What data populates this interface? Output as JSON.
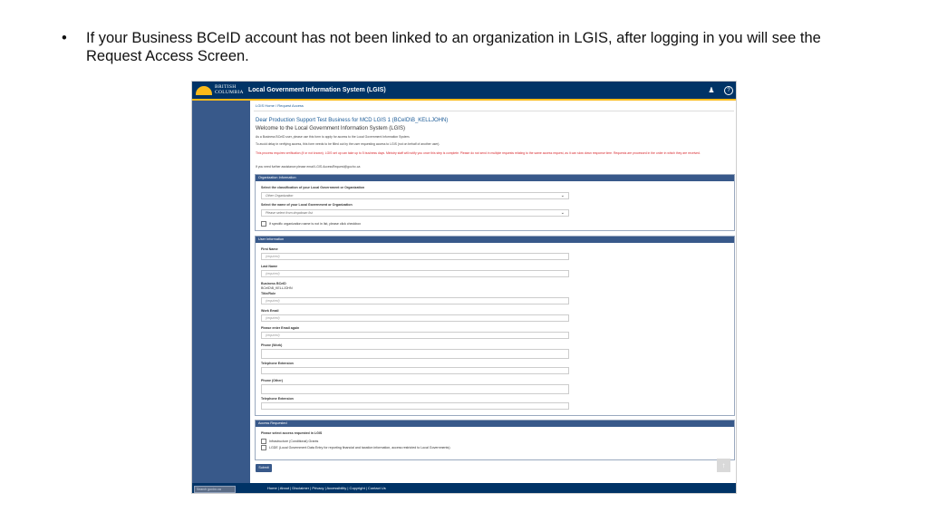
{
  "slide": {
    "bullet_glyph": "•",
    "bullet_text": "If your Business BCeID account has not been linked to an organization in LGIS, after logging in you will see the Request Access Screen."
  },
  "header": {
    "logo_line1": "BRITISH",
    "logo_line2": "COLUMBIA",
    "title": "Local Government Information System (LGIS)",
    "user_icon": "user-icon",
    "help_icon": "help-icon",
    "user_glyph": "♟",
    "help_glyph": "?"
  },
  "breadcrumb": {
    "home": "LGIS Home",
    "separator": " / ",
    "current": "Request Access"
  },
  "intro": {
    "dear": "Dear Production Support Test Business for MCD LGIS 1 (BCeID\\B_KELLJOHN)",
    "welcome": "Welcome to the Local Government Information System (LGIS)",
    "line1": "As a Business BCeID user, please use this form to apply for access to the Local Government Information System.",
    "line2": "To avoid delay in verifying access, this form needs to be filled out by the user requesting access to LGIS (not on behalf of another user).",
    "red_note": "This process requires verification (if or not known). LGIS set up can take up to 5 business days. Ministry staff will notify you once this step is complete. Please do not send in multiple requests relating to the same access request, as it can slow down response time. Requests are processed in the order in which they are received.",
    "assist": "If you need further assistance please email LGIS.AccessRequest@gov.bc.ca"
  },
  "org_panel": {
    "heading": "Organization Information",
    "classification_label": "Select the classification of your Local Government or Organization",
    "classification_value": "Other Organization",
    "name_label": "Select the name of your Local Government or Organization",
    "name_placeholder": "Please select from dropdown list",
    "not_in_list": "If specific organization name is not in list, please click checkbox",
    "chevron_glyph": "⌄"
  },
  "user_panel": {
    "heading": "User Information",
    "first_name_label": "First Name",
    "first_name_placeholder": "(required)",
    "last_name_label": "Last Name",
    "last_name_placeholder": "(required)",
    "bceid_label": "Business BCeID",
    "bceid_value": "BCeID\\B_KELLJOHN",
    "title_label": "Title/Role",
    "title_placeholder": "(required)",
    "email_label": "Work Email",
    "email_placeholder": "(required)",
    "email2_label": "Please enter Email again",
    "email2_placeholder": "(required)",
    "phone_work_label": "Phone (Work)",
    "ext1_label": "Telephone Extension",
    "phone_other_label": "Phone (Other)",
    "ext2_label": "Telephone Extension"
  },
  "access_panel": {
    "heading": "Access Requested",
    "prompt": "Please select access requested in LGIS",
    "option1": "Infrastructure (Conditional) Grants",
    "option2": "LGDE (Local Government Data Entry for reporting financial and taxation information, access restricted to Local Governments)"
  },
  "actions": {
    "submit": "Submit",
    "scroll_top_glyph": "↑"
  },
  "footer": {
    "search_placeholder": "Search gov.bc.ca",
    "links": "Home | About | Disclaimer | Privacy | Accessibility | Copyright | Contact Us"
  },
  "colors": {
    "header_bg": "#003366",
    "accent_gold": "#fcba19",
    "sidebar_bg": "#38598a",
    "link_blue": "#1a5a96",
    "alert_red": "#d8292f"
  }
}
